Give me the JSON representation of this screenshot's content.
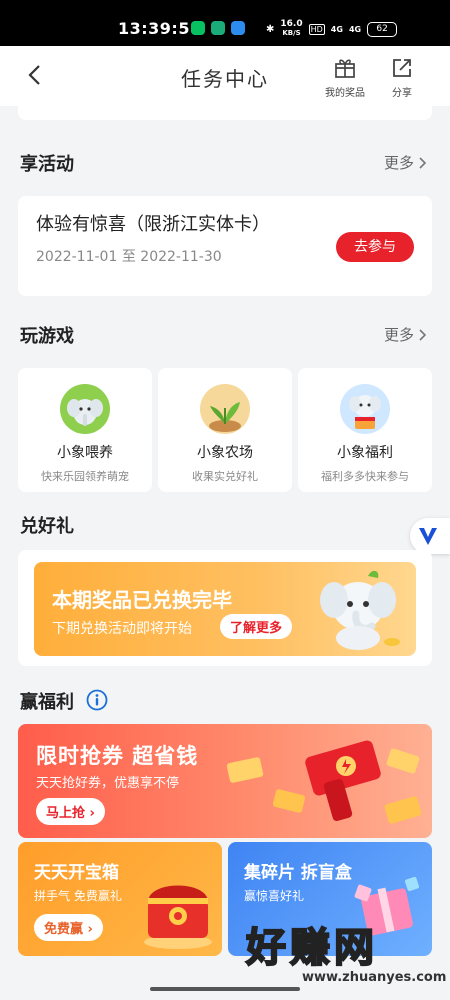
{
  "status_bar": {
    "time": "13:39:58",
    "net_speed_value": "16.0",
    "net_speed_unit": "KB/S",
    "hd_label": "HD",
    "signal_1": "4G",
    "signal_2": "4G",
    "battery": "62"
  },
  "header": {
    "title": "任务中心",
    "my_prizes_label": "我的奖品",
    "share_label": "分享"
  },
  "activities": {
    "title": "享活动",
    "more_label": "更多",
    "event": {
      "title": "体验有惊喜（限浙江实体卡）",
      "date_start": "2022-11-01",
      "date_sep": "至",
      "date_end": "2022-11-30",
      "join_label": "去参与"
    }
  },
  "games": {
    "title": "玩游戏",
    "more_label": "更多",
    "items": [
      {
        "name": "小象喂养",
        "desc": "快来乐园领养萌宠",
        "icon": "elephant-feed-icon"
      },
      {
        "name": "小象农场",
        "desc": "收果实兑好礼",
        "icon": "farm-plant-icon"
      },
      {
        "name": "小象福利",
        "desc": "福利多多快来参与",
        "icon": "elephant-welfare-icon"
      }
    ]
  },
  "redeem": {
    "title": "兑好礼",
    "banner_title": "本期奖品已兑换完毕",
    "banner_subtitle": "下期兑换活动即将开始",
    "learn_more_label": "了解更多"
  },
  "welfare": {
    "title": "赢福利",
    "coupon": {
      "title": "限时抢券 超省钱",
      "subtitle": "天天抢好券，优惠享不停",
      "button": "马上抢"
    },
    "treasure": {
      "title": "天天开宝箱",
      "subtitle": "拼手气 免费赢礼",
      "button": "免费赢"
    },
    "blindbox": {
      "title": "集碎片 拆盲盒",
      "subtitle": "赢惊喜好礼"
    }
  },
  "watermark": {
    "main": "好赚网",
    "url": "www.zhuanyes.com"
  },
  "colors": {
    "accent_red": "#e8222b",
    "banner_orange": "#ffae3a",
    "coupon_red": "#ff5d4b",
    "treasure_orange": "#ffa531",
    "blindbox_blue": "#4a8cf5"
  }
}
